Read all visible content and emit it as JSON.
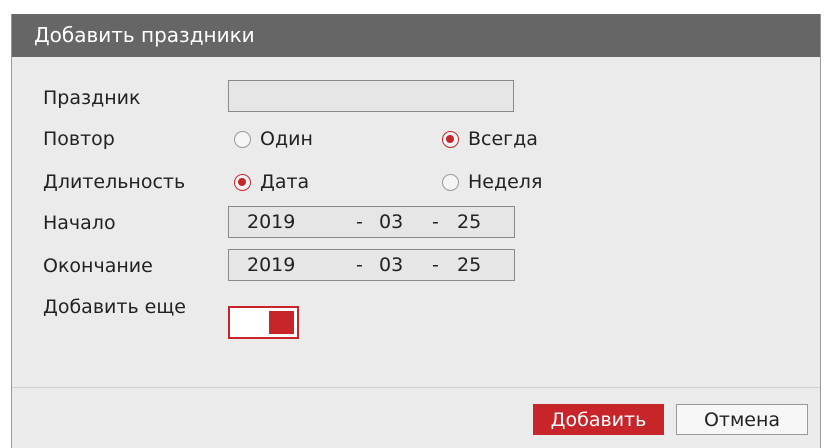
{
  "dialog": {
    "title": "Добавить праздники"
  },
  "form": {
    "holiday": {
      "label": "Праздник",
      "value": ""
    },
    "repeat": {
      "label": "Повтор",
      "options": [
        {
          "label": "Один",
          "checked": false
        },
        {
          "label": "Всегда",
          "checked": true
        }
      ]
    },
    "duration": {
      "label": "Длительность",
      "options": [
        {
          "label": "Дата",
          "checked": true
        },
        {
          "label": "Неделя",
          "checked": false
        }
      ]
    },
    "start": {
      "label": "Начало",
      "year": "2019",
      "sep1": "-",
      "month": "03",
      "sep2": "-",
      "day": "25"
    },
    "end": {
      "label": "Окончание",
      "year": "2019",
      "sep1": "-",
      "month": "03",
      "sep2": "-",
      "day": "25"
    },
    "add_more": {
      "label": "Добавить еще",
      "on": true
    }
  },
  "buttons": {
    "add": "Добавить",
    "cancel": "Отмена"
  },
  "colors": {
    "accent": "#c8252b",
    "titlebar": "#666666",
    "background": "#ebebeb"
  }
}
